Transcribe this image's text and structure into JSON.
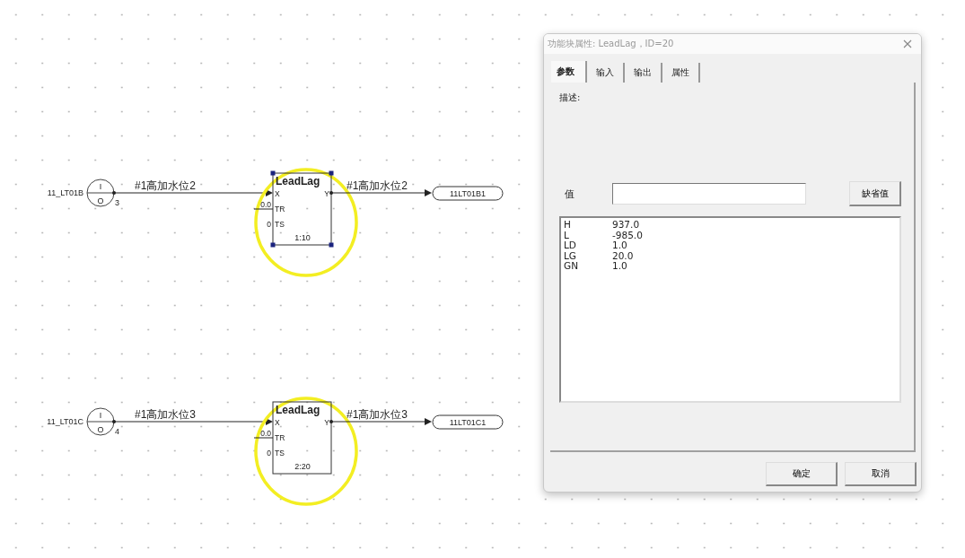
{
  "diagram": {
    "chains": [
      {
        "source": {
          "tag": "11_LT01B",
          "upper": "I",
          "lower": "O",
          "pin": "3"
        },
        "input_signal": "#1高加水位2",
        "block": {
          "title": "LeadLag",
          "inputs": [
            {
              "kind": "linked",
              "label": "X"
            },
            {
              "kind": "stub",
              "label": "TR",
              "constant": "0.0"
            },
            {
              "kind": "constant",
              "label": "TS",
              "constant": "0"
            }
          ],
          "output": "Y",
          "order": "1:10",
          "selected": true,
          "circled": true
        },
        "output_signal": "#1高加水位2",
        "target": "11LT01B1"
      },
      {
        "source": {
          "tag": "11_LT01C",
          "upper": "I",
          "lower": "O",
          "pin": "4"
        },
        "input_signal": "#1高加水位3",
        "block": {
          "title": "LeadLag",
          "inputs": [
            {
              "kind": "linked",
              "label": "X"
            },
            {
              "kind": "stub",
              "label": "TR",
              "constant": "0.0"
            },
            {
              "kind": "constant",
              "label": "TS",
              "constant": "0"
            }
          ],
          "output": "Y",
          "order": "2:20",
          "selected": false,
          "circled": true
        },
        "output_signal": "#1高加水位3",
        "target": "11LT01C1"
      }
    ]
  },
  "dialog": {
    "title": "功能块属性: LeadLag，ID=20",
    "tabs": [
      {
        "label": "参数",
        "selected": true
      },
      {
        "label": "输入",
        "selected": false
      },
      {
        "label": "输出",
        "selected": false
      },
      {
        "label": "属性",
        "selected": false
      }
    ],
    "description_label": "描述:",
    "value_label": "值",
    "default_button": "缺省值",
    "parameters": [
      {
        "name": "H",
        "value": "937.0"
      },
      {
        "name": "L",
        "value": "-985.0"
      },
      {
        "name": "LD",
        "value": "1.0"
      },
      {
        "name": "LG",
        "value": "20.0"
      },
      {
        "name": "GN",
        "value": "1.0"
      }
    ],
    "buttons": [
      "确定",
      "取消"
    ]
  }
}
